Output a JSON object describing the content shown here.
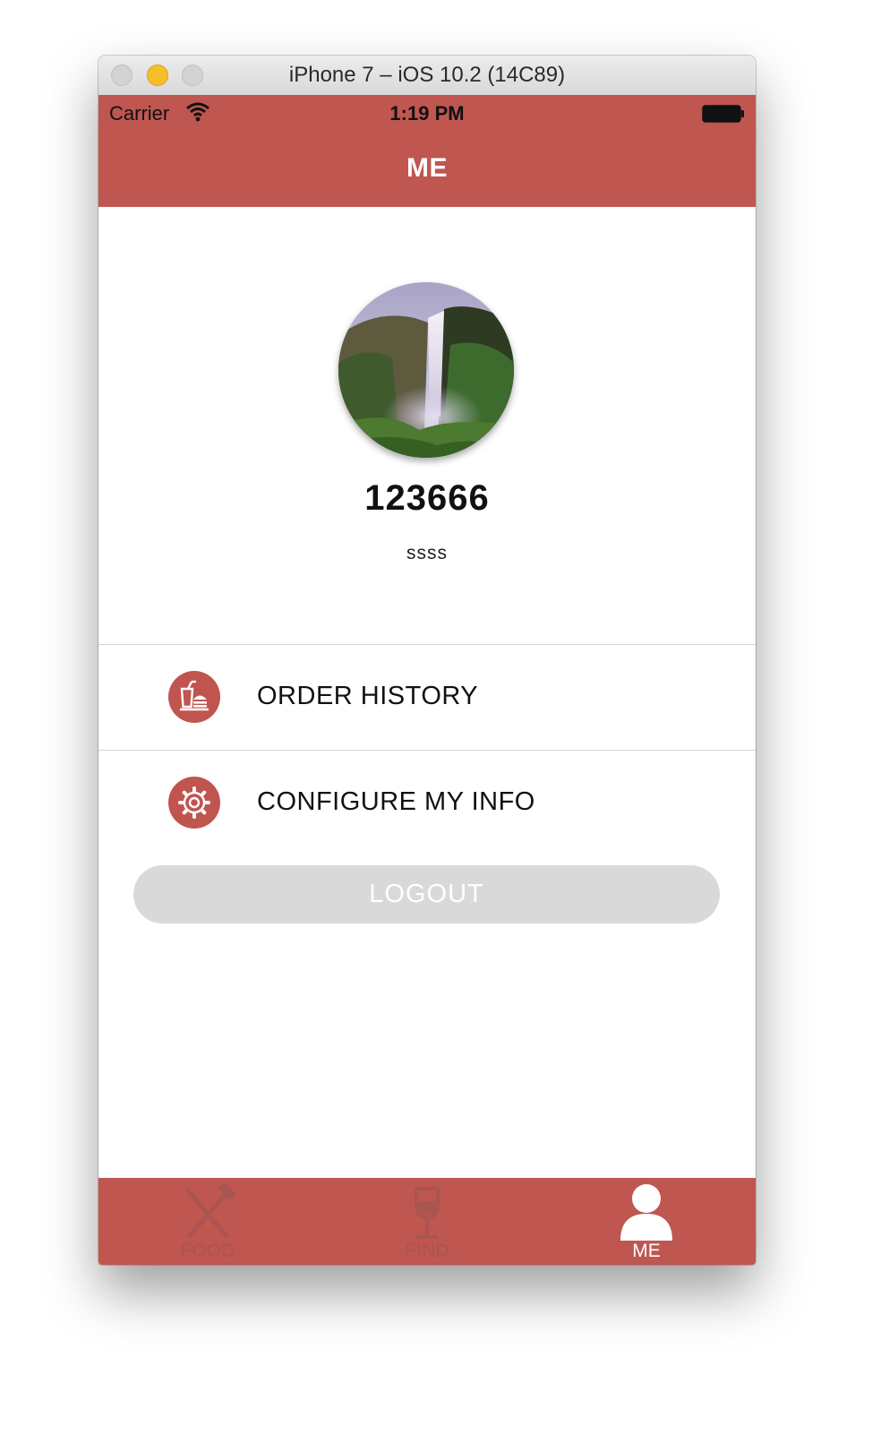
{
  "window": {
    "title": "iPhone 7 – iOS 10.2 (14C89)"
  },
  "status_bar": {
    "carrier": "Carrier",
    "time": "1:19 PM"
  },
  "header": {
    "title": "ME"
  },
  "profile": {
    "username": "123666",
    "subtitle": "ssss"
  },
  "menu": [
    {
      "label": "ORDER HISTORY",
      "icon": "food-drink-icon"
    },
    {
      "label": "CONFIGURE MY INFO",
      "icon": "gear-icon"
    }
  ],
  "logout_label": "LOGOUT",
  "tabs": [
    {
      "label": "FOOD",
      "icon": "fork-knife-icon",
      "active": false
    },
    {
      "label": "FIND",
      "icon": "wine-glass-icon",
      "active": false
    },
    {
      "label": "ME",
      "icon": "person-icon",
      "active": true
    }
  ],
  "colors": {
    "brand": "#bf5650",
    "inactive_tab": "#a95550",
    "logout_bg": "#d9d9d9"
  }
}
